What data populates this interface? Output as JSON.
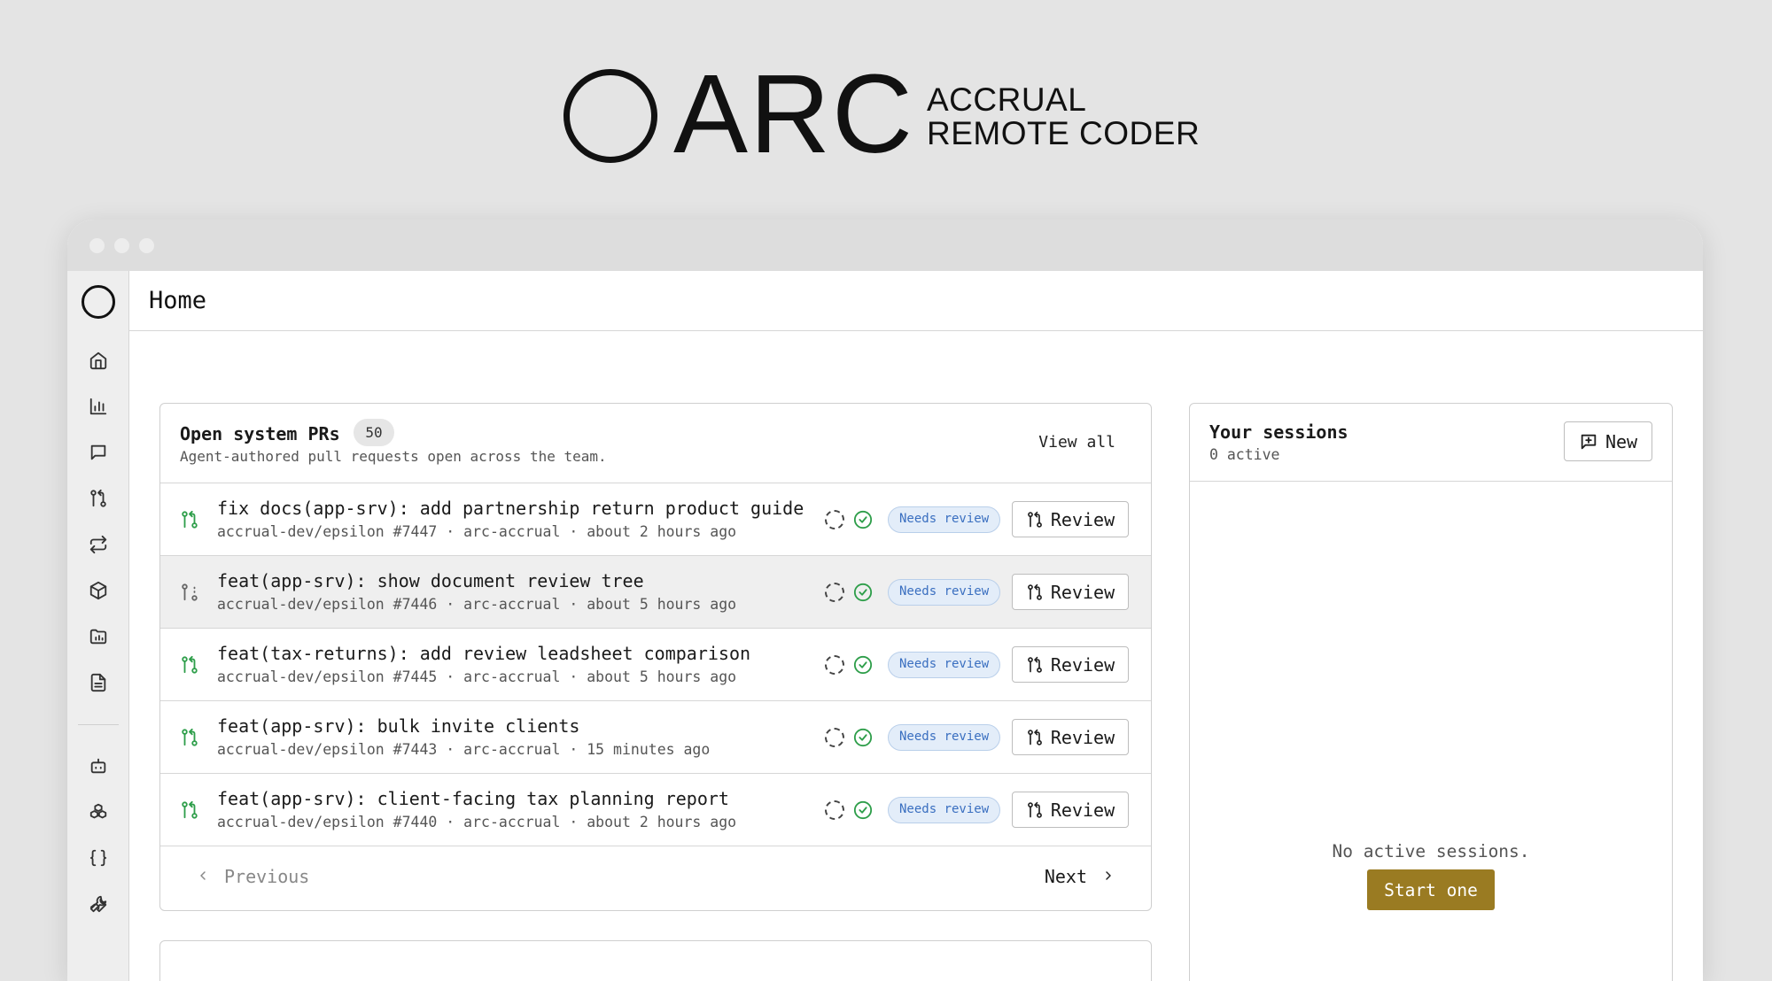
{
  "brand": {
    "name": "ARC",
    "subtitle_line1": "ACCRUAL",
    "subtitle_line2": "REMOTE CODER"
  },
  "header": {
    "title": "Home"
  },
  "sidebar": {
    "items": [
      {
        "icon": "home-icon"
      },
      {
        "icon": "bar-chart-icon"
      },
      {
        "icon": "message-icon"
      },
      {
        "icon": "git-pull-request-icon"
      },
      {
        "icon": "repeat-icon"
      },
      {
        "icon": "package-icon"
      },
      {
        "icon": "folder-chart-icon"
      },
      {
        "icon": "file-text-icon"
      }
    ],
    "bottom_items": [
      {
        "icon": "bot-icon"
      },
      {
        "icon": "boxes-icon"
      },
      {
        "icon": "braces-icon"
      },
      {
        "icon": "wrench-icon"
      }
    ]
  },
  "prs": {
    "title": "Open system PRs",
    "count": "50",
    "subtitle": "Agent-authored pull requests open across the team.",
    "view_all": "View all",
    "status_badge": "Needs review",
    "review_label": "Review",
    "rows": [
      {
        "title": "fix docs(app-srv): add partnership return product guide",
        "meta": "accrual-dev/epsilon #7447 · arc-accrual · about 2 hours ago",
        "state": "open"
      },
      {
        "title": "feat(app-srv): show document review tree",
        "meta": "accrual-dev/epsilon #7446 · arc-accrual · about 5 hours ago",
        "state": "draft"
      },
      {
        "title": "feat(tax-returns): add review leadsheet comparison",
        "meta": "accrual-dev/epsilon #7445 · arc-accrual · about 5 hours ago",
        "state": "open"
      },
      {
        "title": "feat(app-srv): bulk invite clients",
        "meta": "accrual-dev/epsilon #7443 · arc-accrual · 15 minutes ago",
        "state": "open"
      },
      {
        "title": "feat(app-srv): client-facing tax planning report",
        "meta": "accrual-dev/epsilon #7440 · arc-accrual · about 2 hours ago",
        "state": "open"
      }
    ],
    "previous": "Previous",
    "next": "Next"
  },
  "sessions": {
    "title": "Your sessions",
    "active": "0 active",
    "new_label": "New",
    "empty": "No active sessions.",
    "start": "Start one"
  },
  "colors": {
    "accent": "#9a7b22",
    "pr_open": "#2e9e4a",
    "badge_blue": "#3a6fc0"
  }
}
